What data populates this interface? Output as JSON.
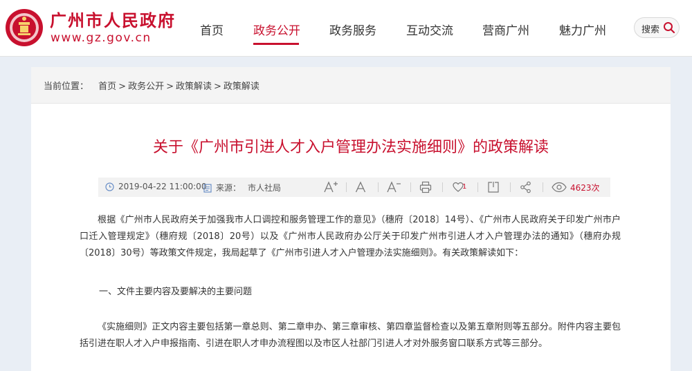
{
  "site": {
    "title": "广州市人民政府",
    "url": "www.gz.gov.cn",
    "brand_color": "#c8102e"
  },
  "nav": {
    "items": [
      {
        "label": "首页"
      },
      {
        "label": "政务公开",
        "active": true
      },
      {
        "label": "政务服务"
      },
      {
        "label": "互动交流"
      },
      {
        "label": "营商广州"
      },
      {
        "label": "魅力广州"
      }
    ],
    "search_label": "搜索",
    "search_icon": "search-icon"
  },
  "breadcrumb": {
    "prefix": "当前位置：",
    "items": [
      "首页",
      "政务公开",
      "政策解读",
      "政策解读"
    ],
    "separator": ">"
  },
  "article": {
    "title": "关于《广州市引进人才入户管理办法实施细则》的政策解读",
    "date": "2019-04-22 11:00:00",
    "source_label": "来源：",
    "source": "市人社局",
    "tools": [
      "font-increase-icon",
      "font-normal-icon",
      "font-decrease-icon",
      "print-icon",
      "like-icon",
      "bookmark-icon",
      "share-icon",
      "eye-icon"
    ],
    "like_count": "1",
    "views": "4623次",
    "paragraph1": "根据《广州市人民政府关于加强我市人口调控和服务管理工作的意见》（穗府〔2018〕14号）、《广州市人民政府关于印发广州市户口迁入管理规定》（穗府规〔2018〕20号）以及《广州市人民政府办公厅关于印发广州市引进人才入户管理办法的通知》（穗府办规〔2018〕30号）等政策文件规定，我局起草了《广州市引进人才入户管理办法实施细则》。有关政策解读如下：",
    "section1_heading": "一、文件主要内容及要解决的主要问题",
    "paragraph2": "《实施细则》正文内容主要包括第一章总则、第二章申办、第三章审核、第四章监督检查以及第五章附则等五部分。附件内容主要包括引进在职人才入户申报指南、引进在职人才申办流程图以及市区人社部门引进人才对外服务窗口联系方式等三部分。"
  }
}
